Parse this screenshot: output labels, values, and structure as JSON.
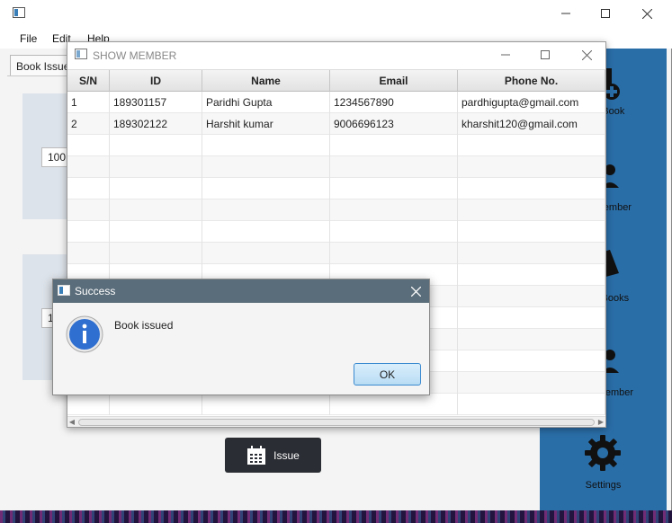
{
  "main": {
    "menu": [
      {
        "label": "File"
      },
      {
        "label": "Edit"
      },
      {
        "label": "Help"
      }
    ],
    "tab_label": "Book Issue",
    "card_field_1": "100",
    "card_field_2": "1",
    "issue_button_label": "Issue"
  },
  "sidebar": {
    "items": [
      {
        "label": "Add Book",
        "icon": "add-book-icon"
      },
      {
        "label": "Add Member",
        "icon": "add-member-icon"
      },
      {
        "label": "View Books",
        "icon": "books-icon"
      },
      {
        "label": "View Member",
        "icon": "members-icon"
      },
      {
        "label": "Settings",
        "icon": "gear-icon"
      }
    ],
    "color": "#2a6ea8"
  },
  "member_window": {
    "title": "SHOW MEMBER",
    "columns": [
      "S/N",
      "ID",
      "Name",
      "Email",
      "Phone No."
    ],
    "rows": [
      {
        "sn": "1",
        "id": "189301157",
        "name": "Paridhi Gupta",
        "email": "1234567890",
        "phone": "pardhigupta@gmail.com"
      },
      {
        "sn": "2",
        "id": "189302122",
        "name": "Harshit kumar",
        "email": "9006696123",
        "phone": "kharshit120@gmail.com"
      }
    ]
  },
  "dialog": {
    "title": "Success",
    "message": "Book issued",
    "ok_label": "OK",
    "title_color": "#5a6d7a",
    "icon": "info-icon"
  }
}
